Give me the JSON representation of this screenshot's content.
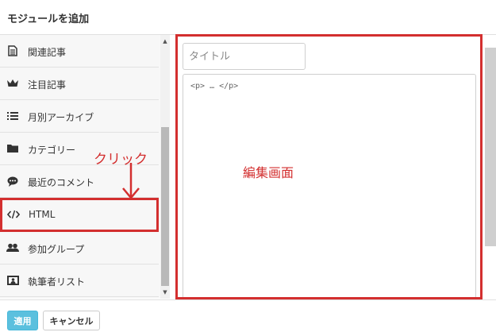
{
  "dialog": {
    "title": "モジュールを追加"
  },
  "sidebar": {
    "items": [
      {
        "label": "関連記事",
        "icon": "document-icon"
      },
      {
        "label": "注目記事",
        "icon": "crown-icon"
      },
      {
        "label": "月別アーカイブ",
        "icon": "list-icon"
      },
      {
        "label": "カテゴリー",
        "icon": "folder-icon"
      },
      {
        "label": "最近のコメント",
        "icon": "comment-icon"
      },
      {
        "label": "HTML",
        "icon": "code-icon",
        "selected": true
      },
      {
        "label": "参加グループ",
        "icon": "users-icon"
      },
      {
        "label": "執筆者リスト",
        "icon": "contact-card-icon"
      }
    ]
  },
  "editor": {
    "title_placeholder": "タイトル",
    "content": "<p> … </p>"
  },
  "annotations": {
    "click_label": "クリック",
    "edit_label": "編集画面",
    "color": "#d32f2f"
  },
  "footer": {
    "apply_label": "適用",
    "cancel_label": "キャンセル"
  },
  "colors": {
    "apply_button": "#5bc0de",
    "highlight": "#d32f2f"
  }
}
